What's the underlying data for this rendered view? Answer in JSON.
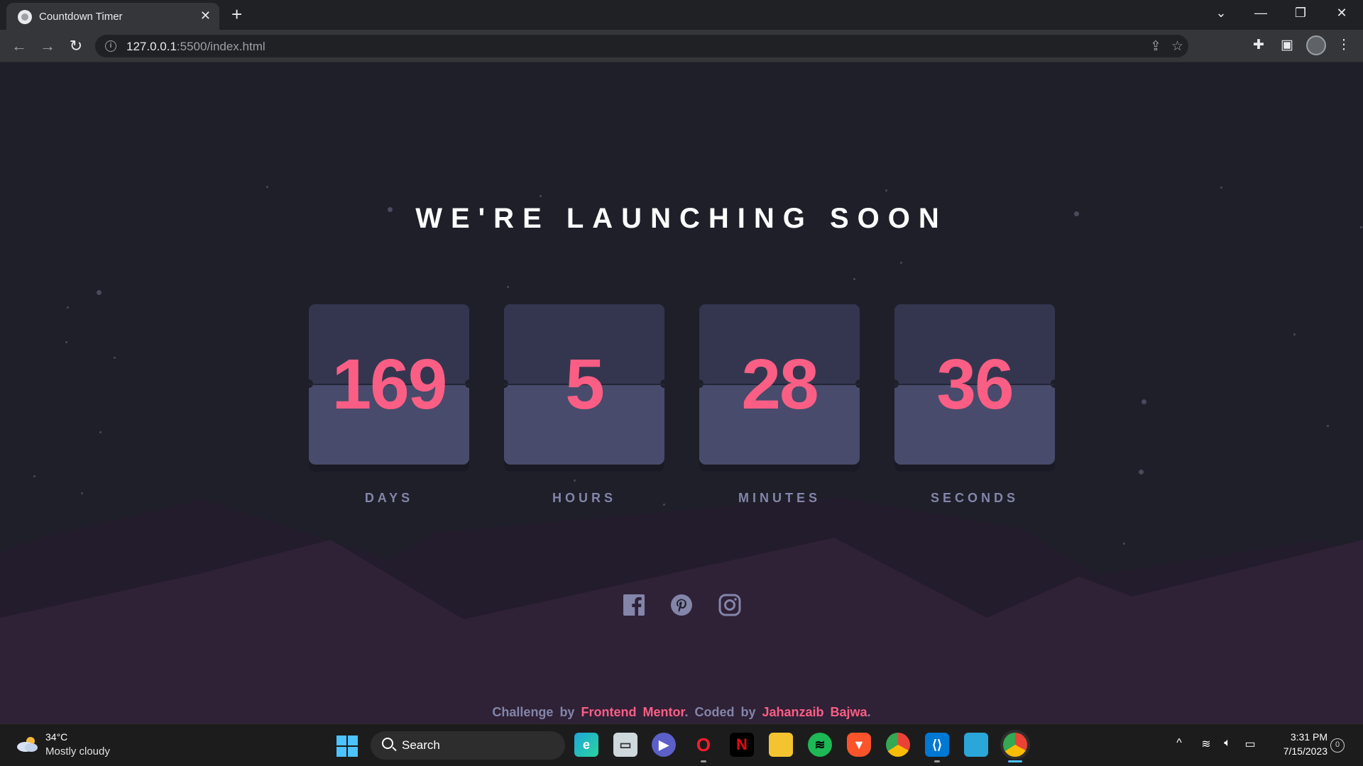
{
  "browser": {
    "tab_title": "Countdown Timer",
    "tab_close": "✕",
    "new_tab": "+",
    "url_host": "127.0.0.1",
    "url_rest": ":5500/index.html",
    "info_glyph": "i"
  },
  "page": {
    "headline": "WE'RE LAUNCHING SOON",
    "countdown": [
      {
        "value": "169",
        "label": "DAYS"
      },
      {
        "value": "5",
        "label": "HOURS"
      },
      {
        "value": "28",
        "label": "MINUTES"
      },
      {
        "value": "36",
        "label": "SECONDS"
      }
    ],
    "socials": [
      "facebook-icon",
      "pinterest-icon",
      "instagram-icon"
    ],
    "attribution": {
      "prefix": "Challenge by",
      "link1": "Frontend Mentor",
      "middle": ". Coded by",
      "link2": "Jahanzaib Bajwa",
      "suffix": "."
    },
    "colors": {
      "background": "#1e1f29",
      "accent": "#fb5e84",
      "card_top": "#34364f",
      "card_bottom": "#484b6b",
      "label": "#8385a9",
      "hills": "#2f2136"
    }
  },
  "taskbar": {
    "weather_temp": "34°C",
    "weather_desc": "Mostly cloudy",
    "search_label": "Search",
    "time": "3:31 PM",
    "date": "7/15/2023",
    "notifications": "0",
    "apps": [
      "edge-beta-icon",
      "task-view-icon",
      "teams-icon",
      "opera-icon",
      "netflix-icon",
      "file-explorer-icon",
      "spotify-icon",
      "brave-icon",
      "chrome-icon",
      "vscode-icon",
      "remote-desktop-icon",
      "chrome-canary-icon"
    ]
  }
}
